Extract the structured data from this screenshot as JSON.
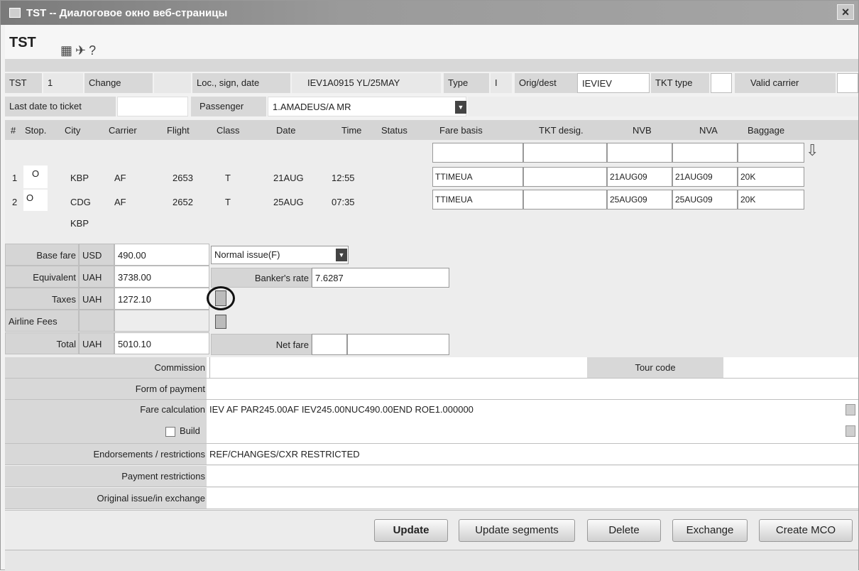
{
  "window": {
    "title": "TST -- Диалоговое окно веб-страницы",
    "close": "×"
  },
  "header": {
    "label": "TST"
  },
  "tst_row": {
    "tst_label": "TST",
    "tst_value": "1",
    "change_label": "Change",
    "loc_label": "Loc., sign, date",
    "loc_value": "IEV1A0915 YL/25MAY",
    "type_label": "Type",
    "type_value": "I",
    "origdest_label": "Orig/dest",
    "origdest_value": "IEVIEV",
    "tkt_type_label": "TKT type",
    "valid_carrier_label": "Valid carrier"
  },
  "row2": {
    "last_date_label": "Last date to ticket",
    "passenger_label": "Passenger",
    "passenger_value": "1.AMADEUS/A MR"
  },
  "segments_header": [
    "#",
    "Stop.",
    "City",
    "Carrier",
    "Flight",
    "Class",
    "Date",
    "Time",
    "Status",
    "Fare basis",
    "TKT desig.",
    "NVB",
    "NVA",
    "Baggage"
  ],
  "segments": [
    {
      "num": "1",
      "stop": "O",
      "city": "KBP",
      "carrier": "AF",
      "flight": "2653",
      "class": "T",
      "date": "21AUG",
      "time": "12:55",
      "fare_basis": "TTIMEUA",
      "tkt_desig": "",
      "nvb": "21AUG09",
      "nva": "21AUG09",
      "baggage": "20K"
    },
    {
      "num": "2",
      "stop": "O",
      "city": "CDG",
      "carrier": "AF",
      "flight": "2652",
      "class": "T",
      "date": "25AUG",
      "time": "07:35",
      "fare_basis": "TTIMEUA",
      "tkt_desig": "",
      "nvb": "25AUG09",
      "nva": "25AUG09",
      "baggage": "20K"
    }
  ],
  "last_city": "KBP",
  "fares": {
    "base_label": "Base fare",
    "base_cur": "USD",
    "base_value": "490.00",
    "issue_value": "Normal issue(F)",
    "equiv_label": "Equivalent",
    "equiv_cur": "UAH",
    "equiv_value": "3738.00",
    "bankers_label": "Banker's rate",
    "bankers_value": "7.6287",
    "taxes_label": "Taxes",
    "taxes_cur": "UAH",
    "taxes_value": "1272.10",
    "airline_fees_label": "Airline Fees",
    "total_label": "Total",
    "total_cur": "UAH",
    "total_value": "5010.10",
    "net_fare_label": "Net fare"
  },
  "commission": {
    "label": "Commission",
    "tour_code_label": "Tour code"
  },
  "form_of_payment": {
    "label": "Form of payment"
  },
  "fare_calc": {
    "label": "Fare calculation",
    "value": "IEV AF PAR245.00AF IEV245.00NUC490.00END ROE1.000000",
    "build_label": "Build"
  },
  "endorsements": {
    "label": "Endorsements / restrictions",
    "value": "REF/CHANGES/CXR RESTRICTED"
  },
  "payment_restrictions": {
    "label": "Payment restrictions"
  },
  "original_issue": {
    "label": "Original issue/in exchange"
  },
  "buttons": {
    "update": "Update",
    "update_segments": "Update segments",
    "delete": "Delete",
    "exchange": "Exchange",
    "create_mco": "Create MCO"
  }
}
